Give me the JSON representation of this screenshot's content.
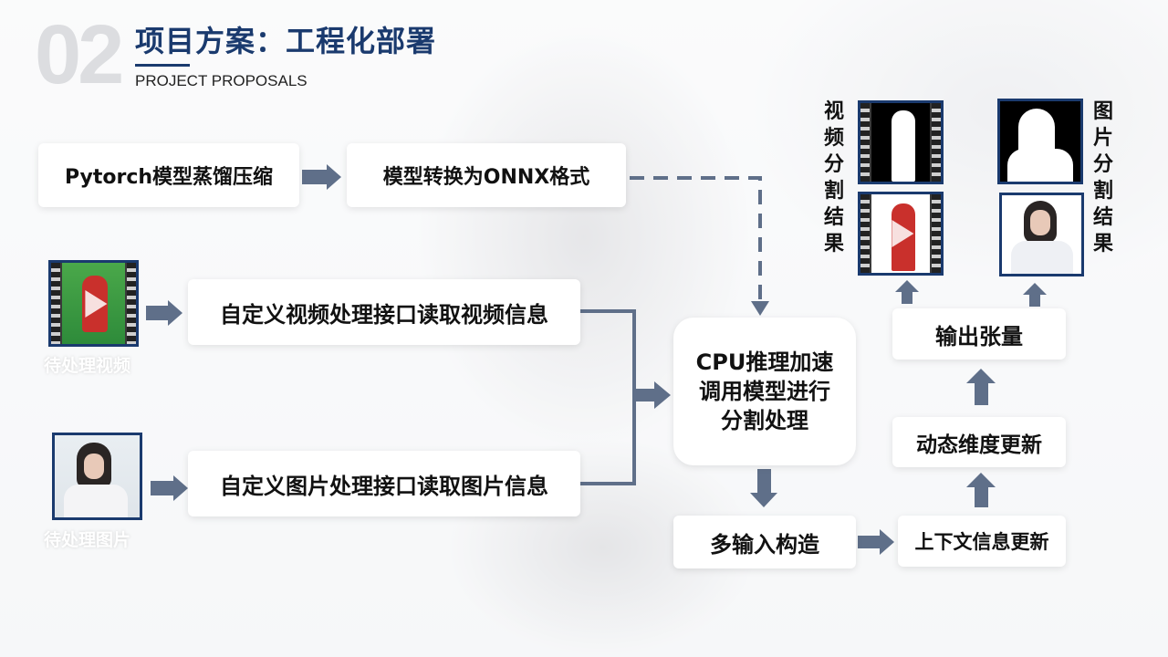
{
  "header": {
    "number": "02",
    "title": "项目方案：工程化部署",
    "subtitle": "PROJECT PROPOSALS"
  },
  "steps": {
    "distill": "Pytorch模型蒸馏压缩",
    "onnx": "模型转换为ONNX格式",
    "video_io": "自定义视频处理接口读取视频信息",
    "image_io": "自定义图片处理接口读取图片信息",
    "cpu_line1": "CPU推理加速",
    "cpu_line2": "调用模型进行",
    "cpu_line3": "分割处理",
    "multi_input": "多输入构造",
    "context_update": "上下文信息更新",
    "dynamic_dim": "动态维度更新",
    "output_tensor": "输出张量"
  },
  "inputs": {
    "video_caption": "待处理视频",
    "image_caption": "待处理图片"
  },
  "results": {
    "video_label": "视频分割结果",
    "image_label": "图片分割结果"
  },
  "colors": {
    "title": "#1a3a6e",
    "arrow": "#5f6f89",
    "box": "#ffffff"
  }
}
